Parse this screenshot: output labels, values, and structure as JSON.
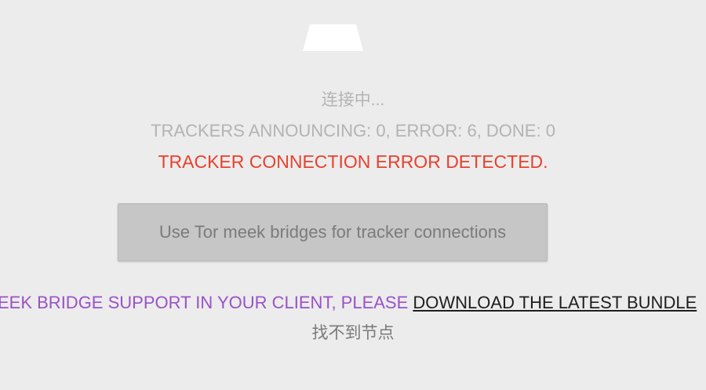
{
  "status": {
    "connecting": "连接中...",
    "tracker_counts": "TRACKERS ANNOUNCING: 0, ERROR: 6, DONE: 0",
    "error_message": "TRACKER CONNECTION ERROR DETECTED."
  },
  "tor_button": {
    "label": "Use Tor meek bridges for tracker connections"
  },
  "bridge_notice": {
    "text": "EEK BRIDGE SUPPORT IN YOUR CLIENT, PLEASE ",
    "link_text": "DOWNLOAD THE LATEST BUNDLE"
  },
  "peers": {
    "not_found": "找不到节点"
  },
  "colors": {
    "background": "#ececec",
    "muted_text": "#b3b3b3",
    "error": "#e8412e",
    "notice_purple": "#9a52c7",
    "button_bg": "#c6c6c6"
  },
  "icons": {
    "logo": "trapezoid-logo"
  }
}
